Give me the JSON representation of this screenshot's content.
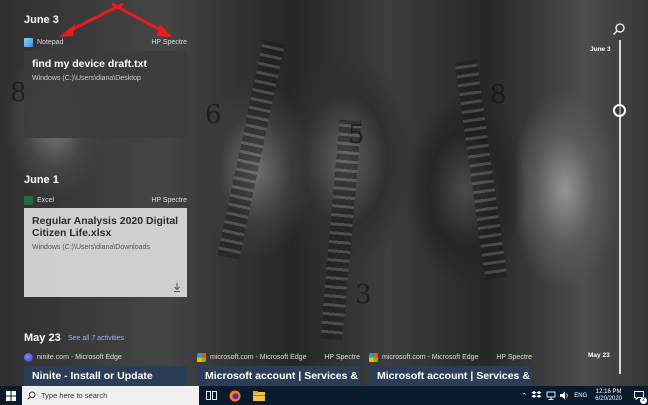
{
  "sections": {
    "june3": {
      "date": "June 3",
      "app": "Notepad",
      "device": "HP Spectre",
      "card_title": "find my device draft.txt",
      "card_path": "Windows (C:)\\Users\\diana\\Desktop"
    },
    "june1": {
      "date": "June 1",
      "app": "Excel",
      "device": "HP Spectre",
      "card_title": "Regular Analysis 2020 Digital Citizen Life.xlsx",
      "card_path": "Windows (C:)\\Users\\diana\\Downloads"
    },
    "may23": {
      "date": "May 23",
      "see_all": "See all 7 activities",
      "items": [
        {
          "app": "ninite.com - Microsoft Edge",
          "device": "",
          "title": "Ninite - Install or Update"
        },
        {
          "app": "microsoft.com - Microsoft Edge",
          "device": "HP Spectre",
          "title": "Microsoft account | Services &"
        },
        {
          "app": "microsoft.com - Microsoft Edge",
          "device": "HP Spectre",
          "title": "Microsoft account | Services &"
        }
      ]
    }
  },
  "timeline": {
    "labels": [
      "June 3",
      "May 23"
    ]
  },
  "taskbar": {
    "search_placeholder": "Type here to search",
    "language": "ENG",
    "time": "12:16 PM",
    "date": "6/20/2020",
    "notification_count": "2"
  },
  "colors": {
    "excel": "#1d6f42",
    "edge_blue": "#0b6fd6",
    "annotation_red": "#e81c1c",
    "taskbar": "#0a1b2e"
  },
  "icons": [
    "windows-logo-icon",
    "search-icon",
    "task-view-icon",
    "firefox-icon",
    "file-explorer-icon",
    "dropbox-icon",
    "network-icon",
    "volume-icon",
    "notification-icon",
    "download-icon",
    "notepad-icon",
    "excel-icon",
    "edge-icon",
    "windows-store-icon"
  ]
}
